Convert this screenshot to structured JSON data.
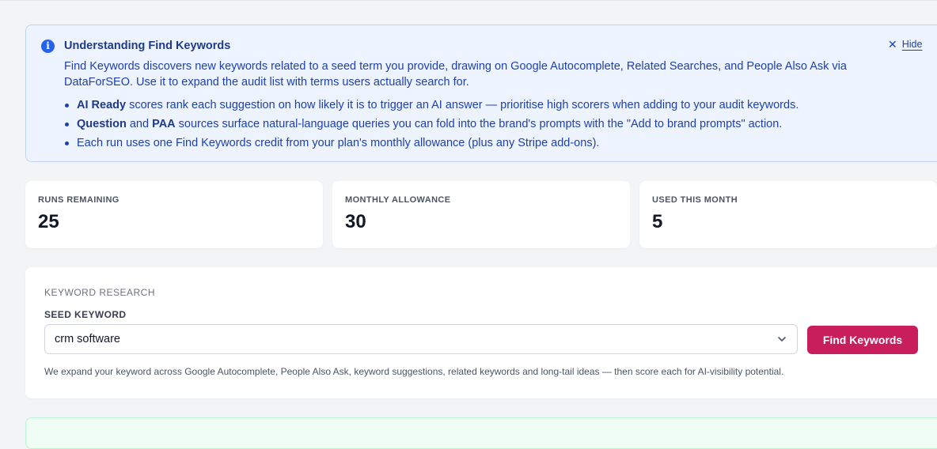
{
  "info": {
    "title": "Understanding Find Keywords",
    "description": "Find Keywords discovers new keywords related to a seed term you provide, drawing on Google Autocomplete, Related Searches, and People Also Ask via DataForSEO. Use it to expand the audit list with terms users actually search for.",
    "bullet1": {
      "bold": "AI Ready",
      "text": " scores rank each suggestion on how likely it is to trigger an AI answer — prioritise high scorers when adding to your audit keywords."
    },
    "bullet2": {
      "bold1": "Question",
      "mid": " and ",
      "bold2": "PAA",
      "text": " sources surface natural-language queries you can fold into the brand's prompts with the \"Add to brand prompts\" action."
    },
    "bullet3": "Each run uses one Find Keywords credit from your plan's monthly allowance (plus any Stripe add-ons).",
    "hide_label": "Hide",
    "icon": "info-icon"
  },
  "stats": [
    {
      "label": "RUNS REMAINING",
      "value": "25"
    },
    {
      "label": "MONTHLY ALLOWANCE",
      "value": "30"
    },
    {
      "label": "USED THIS MONTH",
      "value": "5"
    }
  ],
  "research": {
    "section_title": "KEYWORD RESEARCH",
    "seed_label": "SEED KEYWORD",
    "seed_value": "crm software",
    "button_label": "Find Keywords",
    "help_text": "We expand your keyword across Google Autocomplete, People Also Ask, keyword suggestions, related keywords and long-tail ideas — then score each for AI-visibility potential."
  },
  "colors": {
    "accent": "#c81e5b",
    "info_bg": "#eef4ff",
    "info_text": "#1e40af"
  }
}
